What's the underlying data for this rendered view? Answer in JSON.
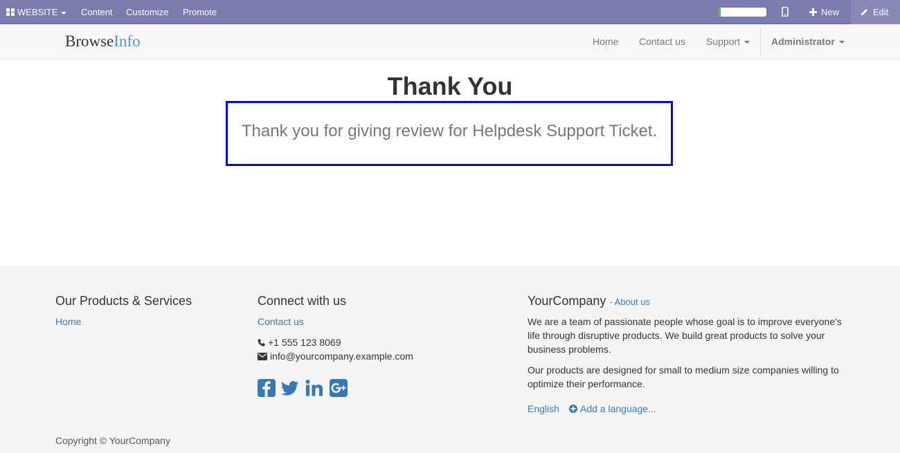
{
  "adminbar": {
    "website_label": "WEBSITE",
    "content_label": "Content",
    "customize_label": "Customize",
    "promote_label": "Promote",
    "progress_fraction": 0.05,
    "new_label": "New",
    "edit_label": "Edit"
  },
  "navbar": {
    "brand_part1": "Browse",
    "brand_part2": "Info",
    "links": [
      "Home",
      "Contact us",
      "Support"
    ],
    "user_label": "Administrator"
  },
  "main": {
    "title": "Thank You",
    "message": "Thank you for giving review for Helpdesk Support Ticket."
  },
  "footer": {
    "col1": {
      "heading": "Our Products & Services",
      "link": "Home"
    },
    "col2": {
      "heading": "Connect with us",
      "link": "Contact us",
      "phone": "+1 555 123 8069",
      "email": "info@yourcompany.example.com",
      "social_icons": [
        "facebook-icon",
        "twitter-icon",
        "linkedin-icon",
        "google-plus-icon"
      ]
    },
    "col3": {
      "heading": "YourCompany",
      "about_link": "- About us",
      "para1_line1": "We are a team of passionate people whose goal is to improve everyone's",
      "para1_line2": "life through disruptive products. We build great products to solve your",
      "para1_line3": "business problems.",
      "para2_line1": "Our products are designed for small to medium size companies willing to",
      "para2_line2": "optimize their performance.",
      "language": "English",
      "add_language": "Add a language..."
    },
    "copyright": "Copyright © YourCompany"
  },
  "colors": {
    "adminbar": "#7c7bad",
    "brand_accent": "#4d97d1",
    "link": "#337ab7",
    "highlight_border": "#0008e8"
  }
}
